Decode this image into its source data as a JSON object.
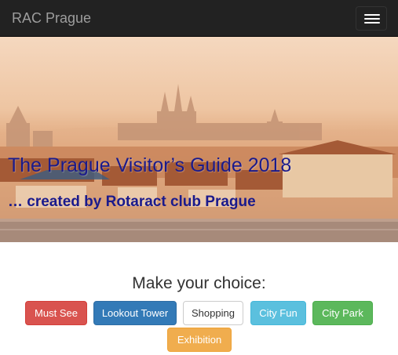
{
  "navbar": {
    "brand": "RAC Prague",
    "toggle_icon": "hamburger-menu-icon",
    "bg_color": "#222222"
  },
  "hero": {
    "title": "The Prague Visitor’s Guide 2018",
    "subtitle": "… created by Rotaract club Prague",
    "text_color": "#1a1a8c",
    "image": "prague-castle-panorama"
  },
  "choices": {
    "heading": "Make your choice:",
    "buttons": [
      {
        "label": "Must See",
        "style": "danger",
        "color": "#d9534f"
      },
      {
        "label": "Lookout Tower",
        "style": "primary",
        "color": "#337ab7"
      },
      {
        "label": "Shopping",
        "style": "default",
        "color": "#ffffff"
      },
      {
        "label": "City Fun",
        "style": "info",
        "color": "#5bc0de"
      },
      {
        "label": "City Park",
        "style": "success",
        "color": "#5cb85c"
      },
      {
        "label": "Exhibition",
        "style": "warning",
        "color": "#f0ad4e"
      }
    ]
  }
}
